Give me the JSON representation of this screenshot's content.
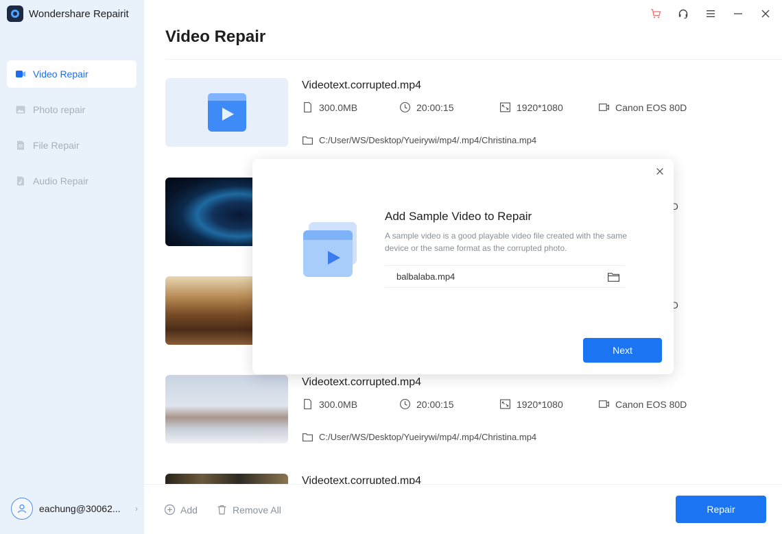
{
  "app": {
    "title": "Wondershare Repairit"
  },
  "sidebar": {
    "items": [
      {
        "label": "Video Repair",
        "icon": "video-icon",
        "active": true
      },
      {
        "label": "Photo repair",
        "icon": "photo-icon",
        "active": false
      },
      {
        "label": "File Repair",
        "icon": "file-icon",
        "active": false
      },
      {
        "label": "Audio Repair",
        "icon": "audio-icon",
        "active": false
      }
    ],
    "user": {
      "name": "eachung@30062..."
    }
  },
  "main": {
    "title": "Video Repair",
    "files": [
      {
        "name": "Videotext.corrupted.mp4",
        "size": "300.0MB",
        "duration": "20:00:15",
        "resolution": "1920*1080",
        "device": "Canon EOS 80D",
        "path": "C:/User/WS/Desktop/Yueirywi/mp4/.mp4/Christina.mp4"
      },
      {
        "name": "",
        "size": "",
        "duration": "",
        "resolution": "",
        "device": "0D",
        "path": ""
      },
      {
        "name": "",
        "size": "",
        "duration": "",
        "resolution": "",
        "device": "0D",
        "path": ""
      },
      {
        "name": "Videotext.corrupted.mp4",
        "size": "300.0MB",
        "duration": "20:00:15",
        "resolution": "1920*1080",
        "device": "Canon EOS 80D",
        "path": "C:/User/WS/Desktop/Yueirywi/mp4/.mp4/Christina.mp4"
      },
      {
        "name": "Videotext.corrupted.mp4"
      }
    ]
  },
  "bottom_bar": {
    "add_label": "Add",
    "remove_all_label": "Remove All",
    "repair_label": "Repair"
  },
  "modal": {
    "title": "Add Sample Video to Repair",
    "description": "A sample video is a good playable video file created with the same device or the same format as the corrupted photo.",
    "sample_file": "balbalaba.mp4",
    "next_label": "Next"
  },
  "colors": {
    "accent": "#1b74f2",
    "sidebar_bg": "#e9f1fb",
    "cart": "#f26d6d"
  }
}
